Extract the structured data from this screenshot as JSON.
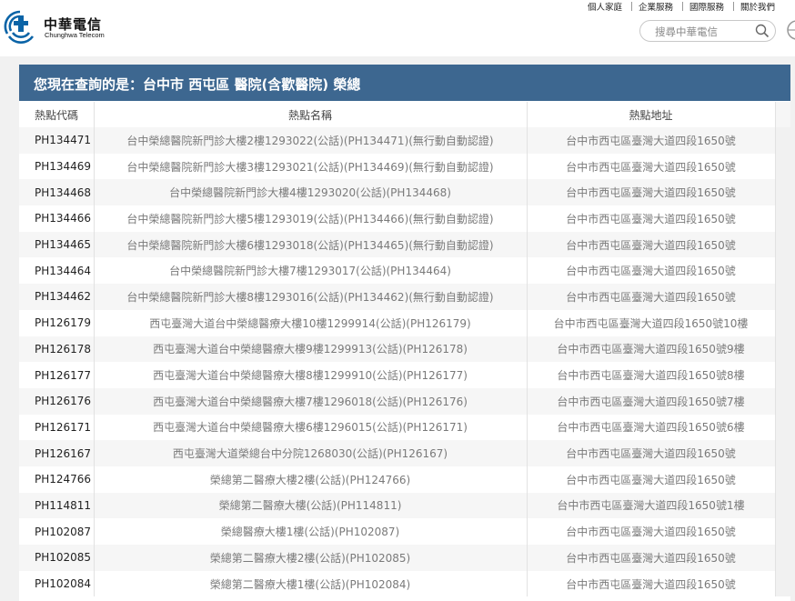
{
  "brand": {
    "name_zh": "中華電信",
    "name_en": "Chunghwa Telecom",
    "logo_color": "#0b64a7"
  },
  "topnav": {
    "items": [
      "個人家庭",
      "企業服務",
      "國際服務",
      "關於我們"
    ]
  },
  "search": {
    "placeholder": "搜尋中華電信",
    "icon": "search-icon"
  },
  "globe_icon": "globe-icon",
  "page": {
    "title": "您現在查詢的是：台中市 西屯區 醫院(含歡醫院) 榮總",
    "title_bar_color": "#3d6790"
  },
  "table": {
    "headers": [
      "熱點代碼",
      "熱點名稱",
      "熱點地址"
    ],
    "rows": [
      {
        "code": "PH134471",
        "name": "台中榮總醫院新門診大樓2樓1293022(公話)(PH134471)(無行動自動認證)",
        "address": "台中市西屯區臺灣大道四段1650號"
      },
      {
        "code": "PH134469",
        "name": "台中榮總醫院新門診大樓3樓1293021(公話)(PH134469)(無行動自動認證)",
        "address": "台中市西屯區臺灣大道四段1650號"
      },
      {
        "code": "PH134468",
        "name": "台中榮總醫院新門診大樓4樓1293020(公話)(PH134468)",
        "address": "台中市西屯區臺灣大道四段1650號"
      },
      {
        "code": "PH134466",
        "name": "台中榮總醫院新門診大樓5樓1293019(公話)(PH134466)(無行動自動認證)",
        "address": "台中市西屯區臺灣大道四段1650號"
      },
      {
        "code": "PH134465",
        "name": "台中榮總醫院新門診大樓6樓1293018(公話)(PH134465)(無行動自動認證)",
        "address": "台中市西屯區臺灣大道四段1650號"
      },
      {
        "code": "PH134464",
        "name": "台中榮總醫院新門診大樓7樓1293017(公話)(PH134464)",
        "address": "台中市西屯區臺灣大道四段1650號"
      },
      {
        "code": "PH134462",
        "name": "台中榮總醫院新門診大樓8樓1293016(公話)(PH134462)(無行動自動認證)",
        "address": "台中市西屯區臺灣大道四段1650號"
      },
      {
        "code": "PH126179",
        "name": "西屯臺灣大道台中榮總醫療大樓10樓1299914(公話)(PH126179)",
        "address": "台中市西屯區臺灣大道四段1650號10樓"
      },
      {
        "code": "PH126178",
        "name": "西屯臺灣大道台中榮總醫療大樓9樓1299913(公話)(PH126178)",
        "address": "台中市西屯區臺灣大道四段1650號9樓"
      },
      {
        "code": "PH126177",
        "name": "西屯臺灣大道台中榮總醫療大樓8樓1299910(公話)(PH126177)",
        "address": "台中市西屯區臺灣大道四段1650號8樓"
      },
      {
        "code": "PH126176",
        "name": "西屯臺灣大道台中榮總醫療大樓7樓1296018(公話)(PH126176)",
        "address": "台中市西屯區臺灣大道四段1650號7樓"
      },
      {
        "code": "PH126171",
        "name": "西屯臺灣大道台中榮總醫療大樓6樓1296015(公話)(PH126171)",
        "address": "台中市西屯區臺灣大道四段1650號6樓"
      },
      {
        "code": "PH126167",
        "name": "西屯臺灣大道榮總台中分院1268030(公話)(PH126167)",
        "address": "台中市西屯區臺灣大道四段1650號"
      },
      {
        "code": "PH124766",
        "name": "榮總第二醫療大樓2樓(公話)(PH124766)",
        "address": "台中市西屯區臺灣大道四段1650號"
      },
      {
        "code": "PH114811",
        "name": "榮總第二醫療大樓(公話)(PH114811)",
        "address": "台中市西屯區臺灣大道四段1650號1樓"
      },
      {
        "code": "PH102087",
        "name": "榮總醫療大樓1樓(公話)(PH102087)",
        "address": "台中市西屯區臺灣大道四段1650號"
      },
      {
        "code": "PH102085",
        "name": "榮總第二醫療大樓2樓(公話)(PH102085)",
        "address": "台中市西屯區臺灣大道四段1650號"
      },
      {
        "code": "PH102084",
        "name": "榮總第二醫療大樓1樓(公話)(PH102084)",
        "address": "台中市西屯區臺灣大道四段1650號"
      }
    ]
  }
}
